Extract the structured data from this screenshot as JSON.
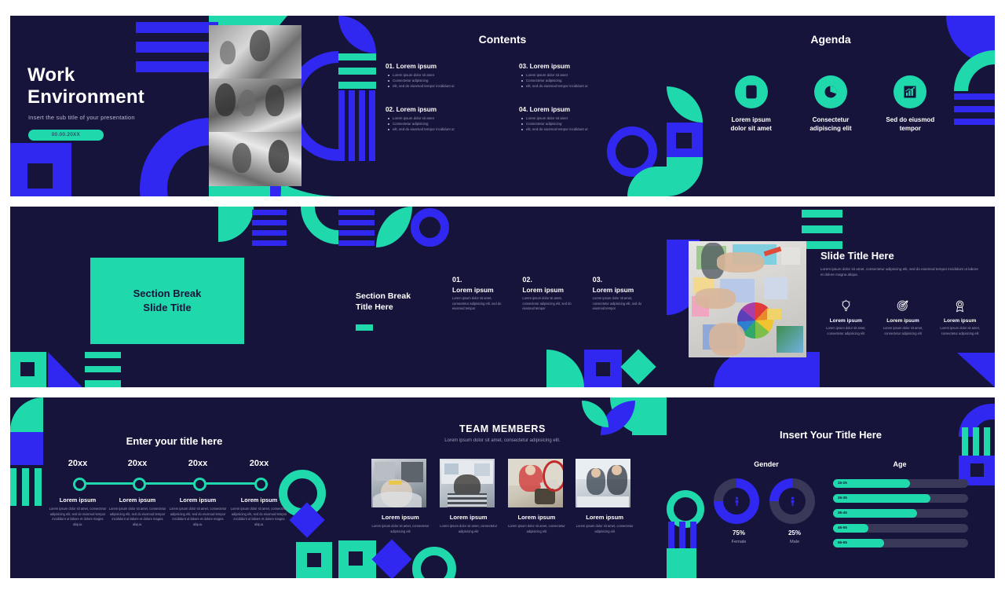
{
  "theme": {
    "bg_dark": "#16143A",
    "accent_green": "#1FD8AC",
    "accent_blue": "#3028F0",
    "text_light": "#FFFFFF",
    "text_muted": "#9E9BB8"
  },
  "slide1": {
    "title_line1": "Work",
    "title_line2": "Environment",
    "subtitle": "Insert the sub title of your presentation",
    "badge": "00.00.20XX"
  },
  "slide2": {
    "title": "Contents",
    "items": [
      {
        "heading": "01. Lorem ipsum",
        "bullets": [
          "Lorem ipsum dolor sit amet",
          "Consectetur adipisicing",
          "elit, sed do eiusmod tempor incididunt ut"
        ]
      },
      {
        "heading": "03. Lorem ipsum",
        "bullets": [
          "Lorem ipsum dolor sit amet",
          "Consectetur adipisicing",
          "elit, sed do eiusmod tempor incididunt ut"
        ]
      },
      {
        "heading": "02. Lorem ipsum",
        "bullets": [
          "Lorem ipsum dolor sit amet",
          "Consectetur adipisicing",
          "elit, sed do eiusmod tempor incididunt ut"
        ]
      },
      {
        "heading": "04. Lorem ipsum",
        "bullets": [
          "Lorem ipsum dolor sit amet",
          "Consectetur adipisicing",
          "elit, sed do eiusmod tempor incididunt ut"
        ]
      }
    ]
  },
  "slide3": {
    "title": "Agenda",
    "items": [
      {
        "icon": "clipboard-list-icon",
        "label": "Lorem ipsum\ndolor sit amet"
      },
      {
        "icon": "pie-chart-icon",
        "label": "Consectetur\nadipiscing elit"
      },
      {
        "icon": "bar-chart-growth-icon",
        "label": "Sed do eiusmod\ntempor"
      }
    ]
  },
  "slide4": {
    "title_line1": "Section Break",
    "title_line2": "Slide Title"
  },
  "slide5": {
    "title_line1": "Section Break",
    "title_line2": "Title Here",
    "columns": [
      {
        "number": "01.",
        "heading": "Lorem ipsum",
        "body": "Lorem ipsum dolor sit amet, consectetur adipisicing elit, sed do eiusmod tempor"
      },
      {
        "number": "02.",
        "heading": "Lorem ipsum",
        "body": "Lorem ipsum dolor sit amet, consectetur adipisicing elit, sed do eiusmod tempor"
      },
      {
        "number": "03.",
        "heading": "Lorem ipsum",
        "body": "Lorem ipsum dolor sit amet, consectetur adipisicing elit, sed do eiusmod tempor"
      }
    ]
  },
  "slide6": {
    "title": "Slide Title Here",
    "body": "Lorem ipsum dolor sit amet, consectetur adipiscing elit, sed do eiusmod tempor incididunt ut labore et dolore magna aliqua.",
    "features": [
      {
        "icon": "lightbulb-icon",
        "heading": "Lorem ipsum",
        "body": "Lorem ipsum dolor sit amet, consectetur adipisicing elit"
      },
      {
        "icon": "target-icon",
        "heading": "Lorem ipsum",
        "body": "Lorem ipsum dolor sit amet, consectetur adipisicing elit"
      },
      {
        "icon": "medal-icon",
        "heading": "Lorem ipsum",
        "body": "Lorem ipsum dolor sit amet, consectetur adipisicing elit"
      }
    ]
  },
  "slide7": {
    "title": "Enter your title here",
    "milestones": [
      {
        "year": "20xx",
        "heading": "Lorem ipsum",
        "body": "Lorem ipsum dolor sit amet, consectetur adipisicing elit, sed do eiusmod tempor incididunt ut labore et dolore magna aliqua."
      },
      {
        "year": "20xx",
        "heading": "Lorem ipsum",
        "body": "Lorem ipsum dolor sit amet, consectetur adipisicing elit, sed do eiusmod tempor incididunt ut labore et dolore magna aliqua."
      },
      {
        "year": "20xx",
        "heading": "Lorem ipsum",
        "body": "Lorem ipsum dolor sit amet, consectetur adipisicing elit, sed do eiusmod tempor incididunt ut labore et dolore magna aliqua."
      },
      {
        "year": "20xx",
        "heading": "Lorem ipsum",
        "body": "Lorem ipsum dolor sit amet, consectetur adipisicing elit, sed do eiusmod tempor incididunt ut labore et dolore magna aliqua."
      }
    ]
  },
  "slide8": {
    "title": "TEAM MEMBERS",
    "subtitle": "Lorem ipsum dolor sit amet, consectetur adipisicing elit.",
    "members": [
      {
        "heading": "Lorem ipsum",
        "body": "Lorem ipsum dolor sit amet, consectetur adipisicing elit"
      },
      {
        "heading": "Lorem ipsum",
        "body": "Lorem ipsum dolor sit amet, consectetur adipisicing elit"
      },
      {
        "heading": "Lorem ipsum",
        "body": "Lorem ipsum dolor sit amet, consectetur adipisicing elit"
      },
      {
        "heading": "Lorem ipsum",
        "body": "Lorem ipsum dolor sit amet, consectetur adipisicing elit"
      }
    ]
  },
  "slide9": {
    "title": "Insert Your Title Here",
    "gender_title": "Gender",
    "age_title": "Age",
    "chart_data": [
      {
        "type": "pie",
        "title": "Gender",
        "categories": [
          "Female",
          "Male"
        ],
        "values": [
          75,
          25
        ],
        "labels": [
          "75%",
          "25%"
        ],
        "unit": "%",
        "legend": "below",
        "colors": [
          "#3028F0",
          "#3A3858"
        ]
      },
      {
        "type": "bar",
        "title": "Age",
        "orientation": "horizontal",
        "categories": [
          "15-25",
          "26-35",
          "36-45",
          "46-55",
          "56-65"
        ],
        "values": [
          57,
          72,
          62,
          26,
          38
        ],
        "xlim": [
          0,
          100
        ],
        "grid": false,
        "color": "#1FD8AC",
        "track_color": "#3A3858"
      }
    ]
  }
}
